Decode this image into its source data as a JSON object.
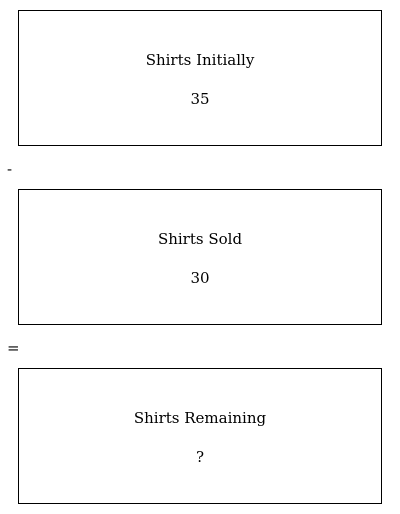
{
  "boxes": [
    {
      "label": "Shirts Initially",
      "value": "35"
    },
    {
      "label": "Shirts Sold",
      "value": "30"
    },
    {
      "label": "Shirts Remaining",
      "value": "?"
    }
  ],
  "operators": [
    "-",
    "="
  ]
}
